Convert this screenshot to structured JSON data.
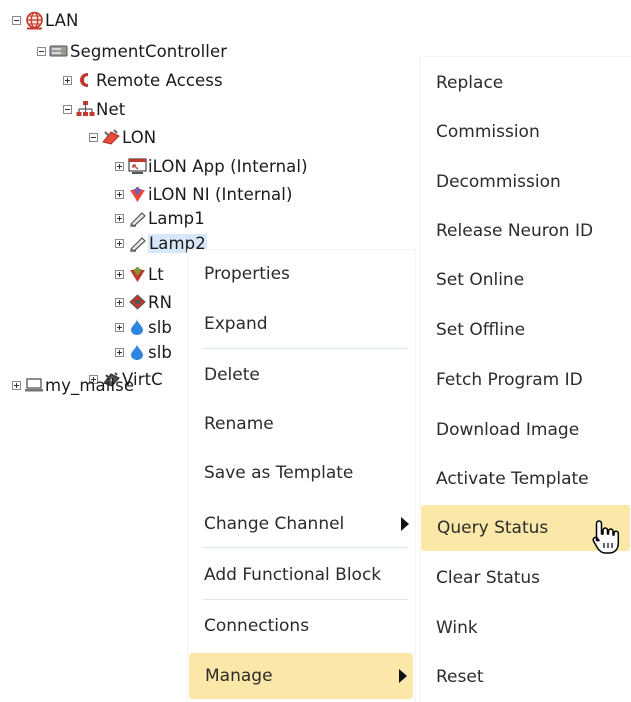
{
  "tree": {
    "nodes": [
      {
        "label": "LAN",
        "icon": "globe-icon",
        "toggle": "minus"
      },
      {
        "label": "SegmentController",
        "icon": "controller-icon",
        "toggle": "minus"
      },
      {
        "label": "Remote Access",
        "icon": "phone-icon",
        "toggle": "plus"
      },
      {
        "label": "Net",
        "icon": "network-icon",
        "toggle": "minus"
      },
      {
        "label": "LON",
        "icon": "lon-icon",
        "toggle": "minus"
      },
      {
        "label": "iLON App (Internal)",
        "icon": "app-icon",
        "toggle": "plus"
      },
      {
        "label": "iLON NI (Internal)",
        "icon": "ni-icon",
        "toggle": "plus"
      },
      {
        "label": "Lamp1",
        "icon": "lamp-icon",
        "toggle": "plus"
      },
      {
        "label": "Lamp2",
        "icon": "lamp-icon",
        "toggle": "plus",
        "selected": true
      },
      {
        "label": "Lt",
        "icon": "ni-icon",
        "toggle": "plus"
      },
      {
        "label": "RN",
        "icon": "router-icon",
        "toggle": "plus"
      },
      {
        "label": "slb",
        "icon": "drop-icon",
        "toggle": "plus"
      },
      {
        "label": "slb",
        "icon": "drop-icon",
        "toggle": "plus"
      },
      {
        "label": "VirtC",
        "icon": "virtual-icon",
        "toggle": "plus"
      },
      {
        "label": "my_mailse",
        "icon": "laptop-icon",
        "toggle": "plus"
      }
    ]
  },
  "context_menu": {
    "items": [
      {
        "label": "Properties"
      },
      {
        "label": "Expand"
      },
      {
        "label": "Delete"
      },
      {
        "label": "Rename"
      },
      {
        "label": "Save as Template"
      },
      {
        "label": "Change Channel",
        "submenu": true
      },
      {
        "label": "Add Functional Block"
      },
      {
        "label": "Connections"
      },
      {
        "label": "Manage",
        "submenu": true,
        "highlighted": true
      }
    ]
  },
  "manage_submenu": {
    "items": [
      {
        "label": "Replace"
      },
      {
        "label": "Commission"
      },
      {
        "label": "Decommission"
      },
      {
        "label": "Release Neuron ID"
      },
      {
        "label": "Set Online"
      },
      {
        "label": "Set Offline"
      },
      {
        "label": "Fetch Program ID"
      },
      {
        "label": "Download Image"
      },
      {
        "label": "Activate Template"
      },
      {
        "label": "Query Status",
        "highlighted": true
      },
      {
        "label": "Clear Status"
      },
      {
        "label": "Wink"
      },
      {
        "label": "Reset"
      }
    ]
  },
  "colors": {
    "highlight": "#fbe8a8",
    "separator": "#dde6ef",
    "selection": "#d8e8fb"
  }
}
